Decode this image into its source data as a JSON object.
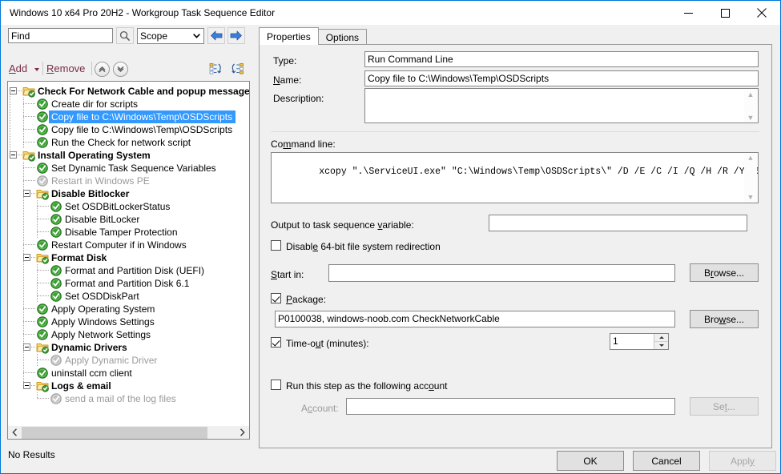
{
  "window": {
    "title": "Windows 10 x64 Pro 20H2 - Workgroup Task Sequence Editor",
    "minimize": "—",
    "maximize": "□",
    "close": "✕"
  },
  "toolbar": {
    "find_value": "Find",
    "find_placeholder": "Find",
    "search_icon": "search-icon",
    "scope_label": "Scope",
    "back_icon": "arrow-left-icon",
    "forward_icon": "arrow-right-icon",
    "add_label": "Add",
    "add_accel": "A",
    "add_rest": "dd",
    "remove_label": "Remove",
    "remove_accel": "R",
    "remove_rest": "emove",
    "move_up_icon": "chevron-up-circle-icon",
    "move_down_icon": "chevron-down-circle-icon",
    "collapse_all_icon": "collapse-list-icon",
    "expand_all_icon": "expand-list-icon"
  },
  "tree": {
    "items": [
      {
        "label": "Check For Network Cable and popup message",
        "depth": 0,
        "type": "folder",
        "state": "enabled",
        "expander": true
      },
      {
        "label": "Create dir for scripts",
        "depth": 1,
        "type": "step",
        "state": "enabled"
      },
      {
        "label": "Copy file to C:\\Windows\\Temp\\OSDScripts",
        "depth": 1,
        "type": "step",
        "state": "selected"
      },
      {
        "label": "Copy file to C:\\Windows\\Temp\\OSDScripts",
        "depth": 1,
        "type": "step",
        "state": "enabled"
      },
      {
        "label": "Run the Check for network script",
        "depth": 1,
        "type": "step",
        "state": "enabled"
      },
      {
        "label": "Install Operating System",
        "depth": 0,
        "type": "folder",
        "state": "enabled",
        "expander": true
      },
      {
        "label": "Set Dynamic Task Sequence Variables",
        "depth": 1,
        "type": "step",
        "state": "enabled"
      },
      {
        "label": "Restart in Windows PE",
        "depth": 1,
        "type": "step",
        "state": "disabled"
      },
      {
        "label": "Disable Bitlocker",
        "depth": 1,
        "type": "folder",
        "state": "enabled",
        "expander": true
      },
      {
        "label": "Set OSDBitLockerStatus",
        "depth": 2,
        "type": "step",
        "state": "enabled"
      },
      {
        "label": "Disable BitLocker",
        "depth": 2,
        "type": "step",
        "state": "enabled"
      },
      {
        "label": "Disable Tamper Protection",
        "depth": 2,
        "type": "step",
        "state": "enabled"
      },
      {
        "label": "Restart Computer if in Windows",
        "depth": 1,
        "type": "step",
        "state": "enabled"
      },
      {
        "label": "Format Disk",
        "depth": 1,
        "type": "folder",
        "state": "enabled",
        "expander": true
      },
      {
        "label": "Format and Partition Disk (UEFI)",
        "depth": 2,
        "type": "step",
        "state": "enabled"
      },
      {
        "label": "Format and Partition Disk 6.1",
        "depth": 2,
        "type": "step",
        "state": "enabled"
      },
      {
        "label": "Set OSDDiskPart",
        "depth": 2,
        "type": "step",
        "state": "enabled"
      },
      {
        "label": "Apply Operating System",
        "depth": 1,
        "type": "step",
        "state": "enabled"
      },
      {
        "label": "Apply Windows Settings",
        "depth": 1,
        "type": "step",
        "state": "enabled"
      },
      {
        "label": "Apply Network Settings",
        "depth": 1,
        "type": "step",
        "state": "enabled"
      },
      {
        "label": "Dynamic Drivers",
        "depth": 1,
        "type": "folder",
        "state": "enabled",
        "expander": true
      },
      {
        "label": "Apply Dynamic Driver",
        "depth": 2,
        "type": "step",
        "state": "disabled"
      },
      {
        "label": "uninstall ccm client",
        "depth": 1,
        "type": "step",
        "state": "enabled"
      },
      {
        "label": "Logs & email",
        "depth": 1,
        "type": "folder",
        "state": "enabled",
        "expander": true
      },
      {
        "label": "send a mail of the log files",
        "depth": 2,
        "type": "step",
        "state": "disabled"
      }
    ],
    "scroll_left_icon": "chevron-left-icon",
    "scroll_right_icon": "chevron-right-icon"
  },
  "status": {
    "text": "No Results"
  },
  "tabs": [
    {
      "label": "Properties",
      "active": true
    },
    {
      "label": "Options",
      "active": false
    }
  ],
  "properties": {
    "type_label": "Type:",
    "type_value": "Run Command Line",
    "name_label": "Name:",
    "name_accel": "N",
    "name_value": "Copy file to C:\\Windows\\Temp\\OSDScripts",
    "description_label": "Description:",
    "description_value": "",
    "command_line_label": "Command line:",
    "command_line_value": "xcopy \".\\ServiceUI.exe\" \"C:\\Windows\\Temp\\OSDScripts\\\" /D /E /C /I /Q /H /R /Y /S",
    "output_var_label": "Output to task sequence variable:",
    "output_var_value": "",
    "disable_redirection_label": "Disable 64-bit file system redirection",
    "disable_redirection_checked": false,
    "start_in_label": "Start in:",
    "start_in_value": "",
    "browse_start_label": "Browse...",
    "package_label": "Package:",
    "package_checked": true,
    "package_value": "P0100038, windows-noob.com CheckNetworkCable",
    "browse_package_label": "Browse...",
    "timeout_label": "Time-out (minutes):",
    "timeout_checked": true,
    "timeout_value": "1",
    "run_as_label": "Run this step as the following account",
    "run_as_checked": false,
    "account_label": "Account:",
    "account_value": "",
    "set_label": "Set...",
    "set_disabled": true,
    "scroll_up_icon": "chevron-up-icon",
    "scroll_down_icon": "chevron-down-icon"
  },
  "footer": {
    "ok_label": "OK",
    "cancel_label": "Cancel",
    "apply_label": "Apply",
    "apply_disabled": true
  },
  "colors": {
    "selection_blue": "#3399ff",
    "accent_border": "#0078d7",
    "command_link": "#7b2d43",
    "panel_bg": "#f0f0f0",
    "success_green": "#3a9e33",
    "folder_yellow": "#fbd46a",
    "disabled_gray": "#9a9a9a"
  }
}
